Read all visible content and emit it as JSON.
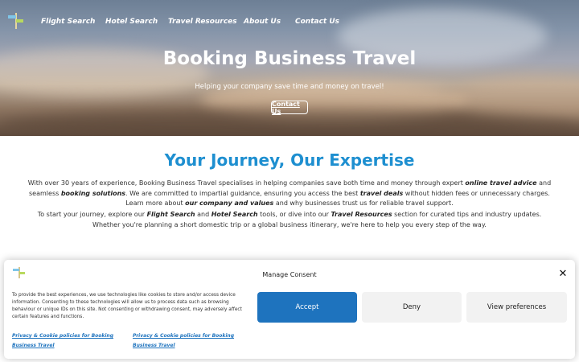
{
  "nav": {
    "items": [
      {
        "label": "Flight Search"
      },
      {
        "label": "Hotel Search"
      },
      {
        "label": "Travel Resources"
      },
      {
        "label": "About Us"
      },
      {
        "label": "Contact Us"
      }
    ]
  },
  "hero": {
    "title": "Booking Business Travel",
    "subtitle": "Helping your company save time and money on travel!",
    "button_label": "Contact Us"
  },
  "main": {
    "section_title": "Your Journey, Our Expertise",
    "p1": {
      "t1": "With over 30 years of experience, Booking Business Travel specialises in helping companies save both time and money through expert ",
      "b1": "online travel advice",
      "t2": " and seamless ",
      "b2": "booking solutions",
      "t3": ". We are committed to impartial guidance, ensuring you access the best ",
      "b3": "travel deals",
      "t4": " without hidden fees or unnecessary charges. Learn more about ",
      "b4": "our company and values",
      "t5": " and why businesses trust us for reliable travel support."
    },
    "p2": {
      "t1": "To start your journey, explore our ",
      "b1": "Flight Search",
      "t2": " and ",
      "b2": "Hotel Search",
      "t3": " tools, or dive into our ",
      "b3": "Travel Resources",
      "t4": " section for curated tips and industry updates. Whether you're planning a short domestic trip or a global business itinerary, we're here to help you every step of the way."
    }
  },
  "consent": {
    "title": "Manage Consent",
    "close_icon": "close-icon",
    "text": "To provide the best experiences, we use technologies like cookies to store and/or access device information. Consenting to these technologies will allow us to process data such as browsing behaviour or unique IDs on this site. Not consenting or withdrawing consent, may adversely affect certain features and functions.",
    "accept_label": "Accept",
    "deny_label": "Deny",
    "prefs_label": "View preferences",
    "policy_link_1": "Privacy & Cookie policies for Booking Business Travel",
    "policy_link_2": "Privacy & Cookie policies for Booking Business Travel"
  },
  "colors": {
    "accent": "#1e8fd0",
    "accept_button": "#1e73be"
  }
}
